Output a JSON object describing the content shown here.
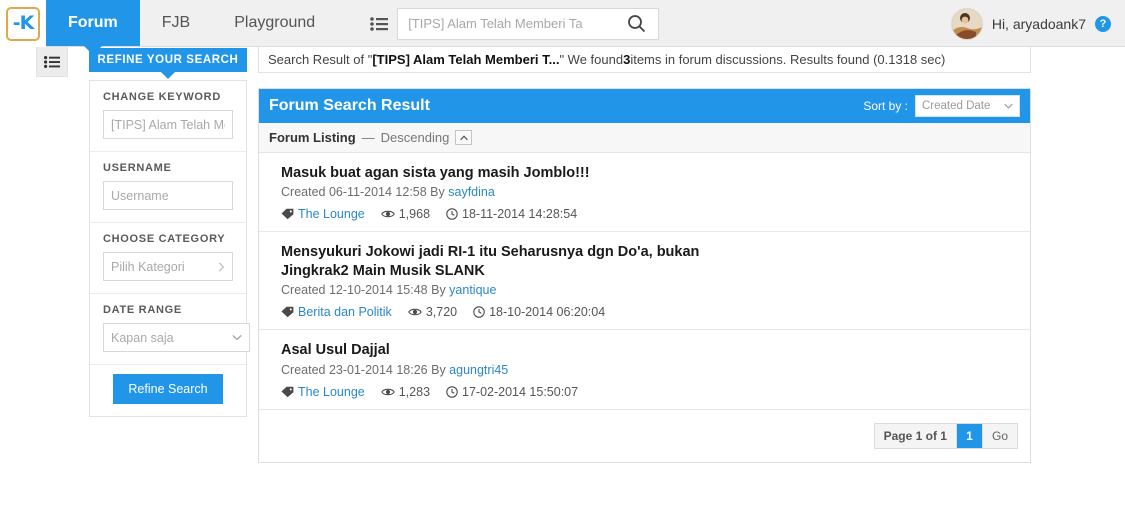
{
  "header": {
    "logo_text": "K",
    "nav": [
      {
        "label": "Forum",
        "active": true
      },
      {
        "label": "FJB",
        "active": false
      },
      {
        "label": "Playground",
        "active": false
      }
    ],
    "search": {
      "value": "",
      "placeholder": "[TIPS] Alam Telah Memberi Ta",
      "list_icon": "list-icon",
      "search_icon": "search-icon"
    },
    "user": {
      "greeting": "Hi, aryadoank7",
      "help_icon": "question-mark-icon",
      "avatar": "user-avatar"
    }
  },
  "rail": {
    "toggle_icon": "list-icon"
  },
  "notice": {
    "prefix": "Search Result of \"",
    "query": "[TIPS] Alam Telah Memberi T...",
    "middle": "\" We found ",
    "count": "3",
    "suffix": " items in forum discussions. Results found (0.1318 sec)"
  },
  "sidebar": {
    "tab_label": "REFINE YOUR SEARCH",
    "blocks": [
      {
        "label": "CHANGE KEYWORD",
        "value": "",
        "placeholder": "[TIPS] Alam Telah Me",
        "type": "input"
      },
      {
        "label": "USERNAME",
        "value": "",
        "placeholder": "Username",
        "type": "input"
      },
      {
        "label": "CHOOSE CATEGORY",
        "value": "Pilih Kategori",
        "type": "select-right"
      },
      {
        "label": "DATE RANGE",
        "value": "Kapan saja",
        "type": "select-down"
      }
    ],
    "refine_button": "Refine Search"
  },
  "panel": {
    "title": "Forum Search Result",
    "sort_by_label": "Sort by :",
    "sort_value": "Created Date",
    "listing_label": "Forum Listing",
    "listing_dash": "—",
    "listing_order": "Descending",
    "results": [
      {
        "title": "Masuk buat agan sista yang masih Jomblo!!!",
        "created_prefix": "Created 06-11-2014 12:58 By ",
        "author": "sayfdina",
        "category": "The Lounge",
        "views": "1,968",
        "last_post": "18-11-2014 14:28:54"
      },
      {
        "title": "Mensyukuri Jokowi jadi RI-1 itu Seharusnya dgn Do'a, bukan Jingkrak2 Main Musik SLANK",
        "created_prefix": "Created 12-10-2014 15:48 By ",
        "author": "yantique",
        "category": "Berita dan Politik",
        "views": "3,720",
        "last_post": "18-10-2014 06:20:04"
      },
      {
        "title": "Asal Usul Dajjal",
        "created_prefix": "Created 23-01-2014 18:26 By ",
        "author": "agungtri45",
        "category": "The Lounge",
        "views": "1,283",
        "last_post": "17-02-2014 15:50:07"
      }
    ],
    "pagination": {
      "page_info": "Page 1 of 1",
      "current_page": "1",
      "go_label": "Go"
    }
  },
  "colors": {
    "brand_blue": "#2196e8",
    "link_blue": "#2a88c8",
    "logo_border": "#e0a848"
  }
}
